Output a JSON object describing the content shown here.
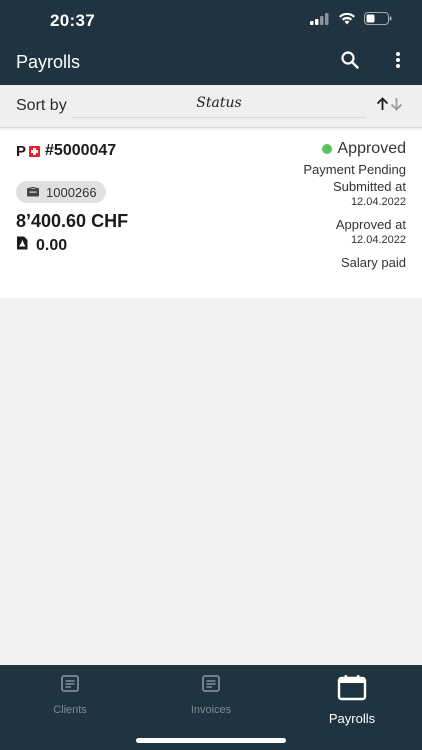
{
  "status_bar": {
    "time": "20:37"
  },
  "app_bar": {
    "title": "Payrolls",
    "actions": [
      "search-icon",
      "more-vertical-icon"
    ]
  },
  "sort": {
    "label": "Sort by",
    "value": "Status"
  },
  "payroll": {
    "prefix": "P",
    "id": "#5000047",
    "client_id": "1000266",
    "amount": "8’400.60 CHF",
    "pdf_value": "0.00",
    "status": "Approved",
    "status_color": "#5cc25a",
    "payment_status": "Payment Pending",
    "submitted_label": "Submitted at",
    "submitted_date": "12.04.2022",
    "approved_label": "Approved at",
    "approved_date": "12.04.2022",
    "salary_status": "Salary paid"
  },
  "bottom_nav": {
    "items": [
      {
        "label": "Clients",
        "icon": "document-icon",
        "active": false
      },
      {
        "label": "Invoices",
        "icon": "document-icon",
        "active": false
      },
      {
        "label": "Payrolls",
        "icon": "calendar-icon",
        "active": true
      }
    ]
  },
  "colors": {
    "header_bg": "#1f3440",
    "background": "#f2f2f2",
    "accent_green": "#5cc25a",
    "flag_red": "#e5202a"
  }
}
